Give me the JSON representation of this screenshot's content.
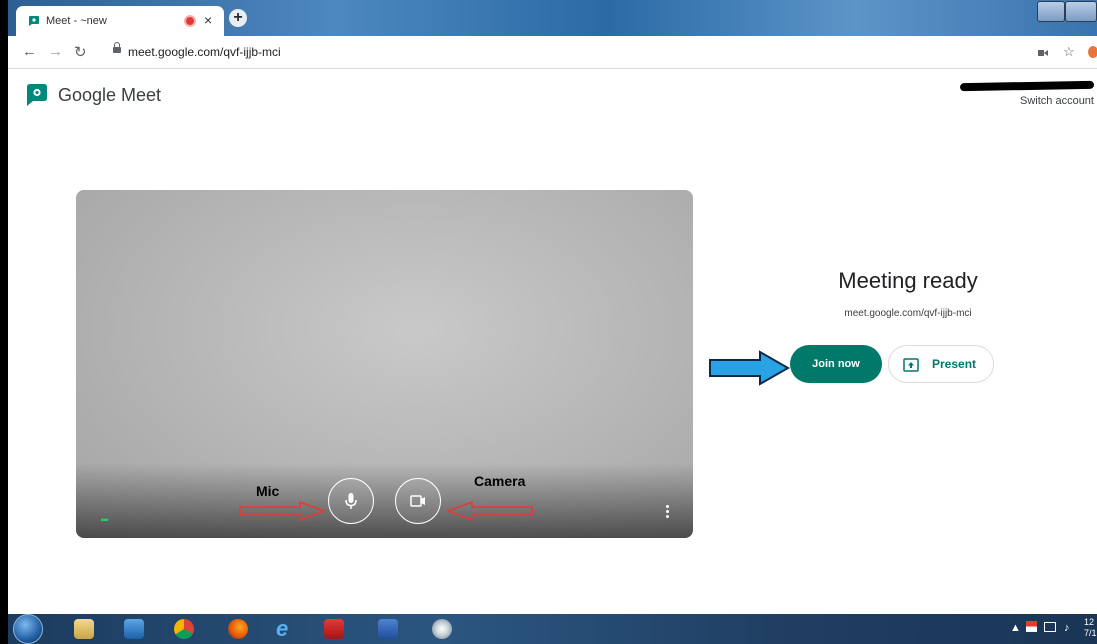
{
  "browser": {
    "tab_title": "Meet - ~new",
    "tab_close": "×",
    "new_tab": "+",
    "url": "meet.google.com/qvf-ijjb-mci"
  },
  "header": {
    "brand": "Google Meet",
    "switch_account": "Switch account"
  },
  "preview": {
    "mic_label": "Mic",
    "camera_label": "Camera",
    "dots": "...",
    "icons": [
      "microphone-icon",
      "video-camera-icon",
      "more-vert-icon"
    ]
  },
  "ready": {
    "title": "Meeting ready",
    "url": "meet.google.com/qvf-ijjb-mci",
    "join_label": "Join now",
    "present_label": "Present"
  },
  "taskbar": {
    "clock_time": "12",
    "clock_date": "7/1"
  },
  "colors": {
    "join_button": "#00796b",
    "annotation_arrow_blue": "#29a3e6",
    "annotation_arrow_red": "#e53935",
    "meet_green": "#00897b"
  }
}
